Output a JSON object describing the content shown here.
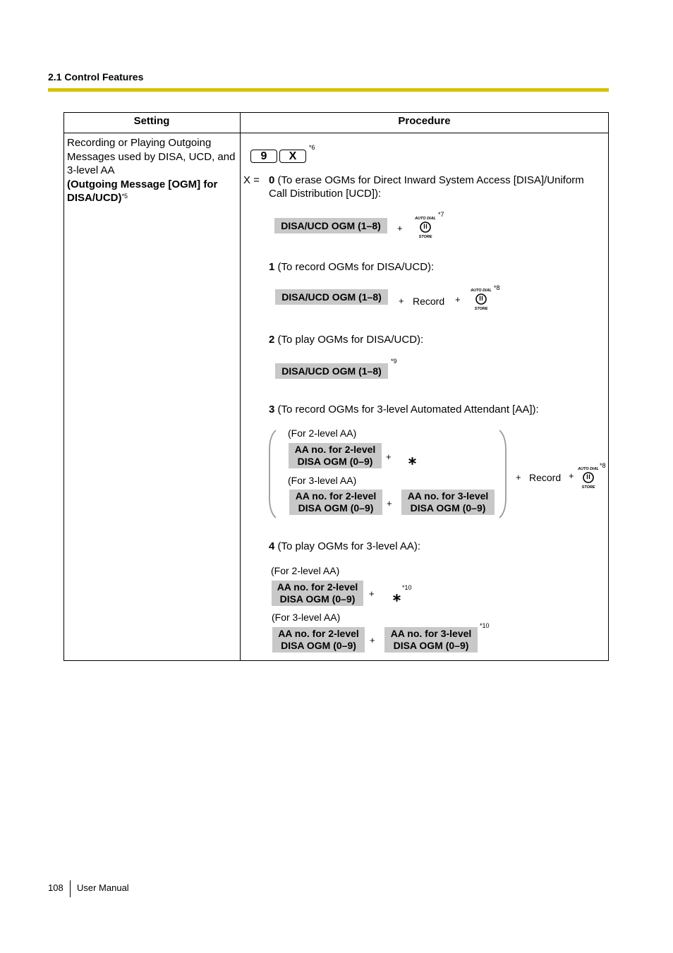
{
  "header": {
    "section_title": "2.1 Control Features",
    "rule_color": "#d8c000"
  },
  "table": {
    "headers": {
      "setting": "Setting",
      "procedure": "Procedure"
    },
    "setting": {
      "description": "Recording or Playing Outgoing Messages used by DISA, UCD, and 3-level AA",
      "name": "(Outgoing Message [OGM] for DISA/UCD)",
      "footnote": "*5"
    },
    "procedure": {
      "keys": [
        "9",
        "X"
      ],
      "keys_footnote": "*6",
      "x_label": "X =",
      "options": [
        {
          "number": "0",
          "text": "(To erase OGMs for Direct Inward System Access [DISA]/Uniform Call Distribution [UCD]):",
          "line1": "(To erase OGMs for Direct Inward System Access [DISA]/Uniform",
          "line2": "Call Distribution [UCD]):",
          "box": "DISA/UCD OGM (1–8)",
          "plus": "+",
          "footnote": "*7"
        },
        {
          "number": "1",
          "text": "(To record OGMs for DISA/UCD):",
          "box": "DISA/UCD OGM (1–8)",
          "plus": "+",
          "record": "Record",
          "footnote": "*8"
        },
        {
          "number": "2",
          "text": "(To play OGMs for DISA/UCD):",
          "box": "DISA/UCD OGM (1–8)",
          "footnote": "*9"
        },
        {
          "number": "3",
          "text": "(To record OGMs for 3-level Automated Attendant [AA]):",
          "for_2level": "(For 2-level AA)",
          "for_3level": "(For 3-level AA)",
          "box_2level_l1": "AA no. for 2-level",
          "box_2level_l2": "DISA OGM (0–9)",
          "box_3level_l1": "AA no. for 3-level",
          "box_3level_l2": "DISA OGM (0–9)",
          "plus": "+",
          "star": "⁎",
          "record": "Record",
          "footnote": "*8"
        },
        {
          "number": "4",
          "text": "(To play OGMs for 3-level AA):",
          "for_2level": "(For 2-level AA)",
          "for_3level": "(For 3-level AA)",
          "box_2level_l1": "AA no. for 2-level",
          "box_2level_l2": "DISA OGM (0–9)",
          "box_3level_l1": "AA no. for 3-level",
          "box_3level_l2": "DISA OGM (0–9)",
          "plus": "+",
          "star": "⁎",
          "footnote": "*10"
        }
      ],
      "store_button": {
        "top_label": "AUTO DIAL",
        "bottom_label": "STORE",
        "icon": "auto-dial-store-button-icon"
      }
    }
  },
  "footer": {
    "page_number": "108",
    "label": "User Manual"
  }
}
